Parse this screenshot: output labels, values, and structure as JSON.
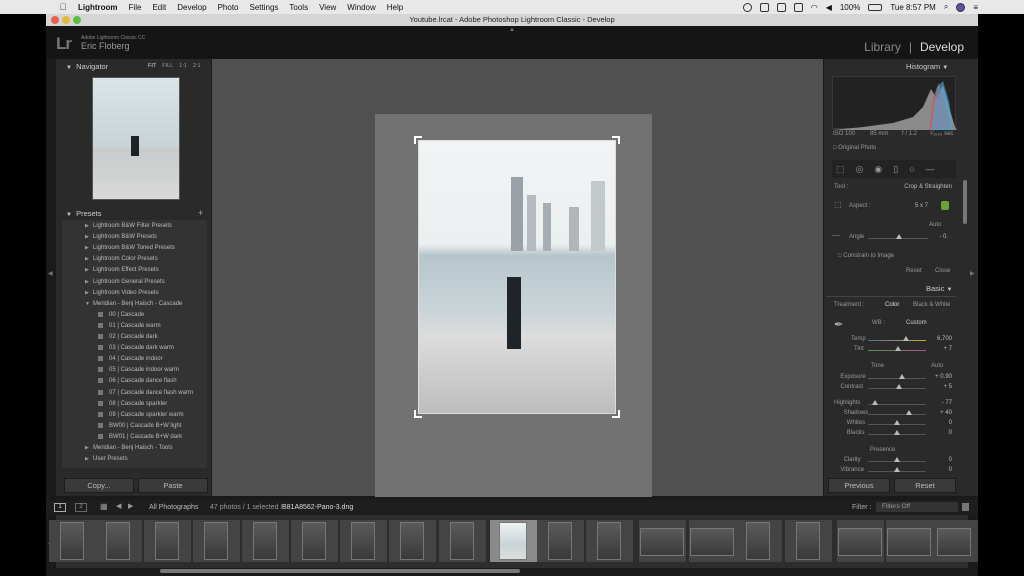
{
  "menubar": {
    "apple": "",
    "items": [
      "Lightroom",
      "File",
      "Edit",
      "Develop",
      "Photo",
      "Settings",
      "Tools",
      "View",
      "Window",
      "Help"
    ],
    "battery": "100%",
    "clock": "Tue 8:57 PM"
  },
  "window": {
    "title": "Youtube.lrcat - Adobe Photoshop Lightroom Classic - Develop"
  },
  "identity": {
    "logo": "Lr",
    "product": "Adobe Lightroom Classic CC",
    "user": "Eric Floberg"
  },
  "modules": {
    "library": "Library",
    "separator": "|",
    "develop": "Develop"
  },
  "navigator": {
    "title": "Navigator",
    "zoom_options": [
      "FIT",
      "FILL",
      "1:1",
      "2:1"
    ]
  },
  "presets": {
    "title": "Presets",
    "add": "+",
    "groups": [
      "Lightroom B&W Filter Presets",
      "Lightroom B&W Presets",
      "Lightroom B&W Toned Presets",
      "Lightroom Color Presets",
      "Lightroom Effect Presets",
      "Lightroom General Presets",
      "Lightroom Video Presets",
      "Meridian - Benj Haisch - Cascade"
    ],
    "items": [
      "00 | Cascade",
      "01 | Cascade warm",
      "02 | Cascade dark",
      "03 | Cascade dark warm",
      "04 | Cascade indoor",
      "05 | Cascade indoor warm",
      "06 | Cascade dance flash",
      "07 | Cascade dance flash warm",
      "08 | Cascade sparkler",
      "09 | Cascade sparkler warm",
      "BW00 | Cascade B+W light",
      "BW01 | Cascade B+W dark"
    ],
    "after": [
      "Meridian - Benj Haisch - Tools",
      "User Presets"
    ]
  },
  "left_buttons": {
    "copy": "Copy...",
    "paste": "Paste"
  },
  "histogram": {
    "title": "Histogram",
    "iso": "ISO 100",
    "focal": "85 mm",
    "aperture": "f / 1.2",
    "shutter": "¹⁄₁₆₀₀ sec",
    "original": "Original Photo"
  },
  "crop": {
    "tool_label": "Tool :",
    "tool_value": "Crop & Straighten",
    "aspect_label": "Aspect :",
    "aspect_value": "5 x 7",
    "auto": "Auto",
    "angle_label": "Angle",
    "angle_value": "- 0.",
    "constrain": "Constrain to Image",
    "reset": "Reset",
    "close": "Close"
  },
  "basic": {
    "title": "Basic",
    "treatment_label": "Treatment :",
    "color": "Color",
    "bw": "Black & White",
    "wb_label": "WB :",
    "wb_value": "Custom",
    "temp_label": "Temp",
    "temp_value": "6,700",
    "tint_label": "Tint",
    "tint_value": "+ 7",
    "tone_label": "Tone",
    "tone_auto": "Auto",
    "sliders": [
      {
        "label": "Exposure",
        "value": "+ 0.90",
        "level": 0.58
      },
      {
        "label": "Contrast",
        "value": "+ 5",
        "level": 0.53
      },
      {
        "label": "Highlights",
        "value": "- 77",
        "level": 0.12
      },
      {
        "label": "Shadows",
        "value": "+ 40",
        "level": 0.7
      },
      {
        "label": "Whites",
        "value": "0",
        "level": 0.5
      },
      {
        "label": "Blacks",
        "value": "0",
        "level": 0.5
      }
    ],
    "presence_label": "Presence",
    "presence_sliders": [
      {
        "label": "Clarity",
        "value": "0",
        "level": 0.5
      },
      {
        "label": "Vibrance",
        "value": "0",
        "level": 0.5
      }
    ]
  },
  "right_buttons": {
    "previous": "Previous",
    "reset": "Reset"
  },
  "filmstrip": {
    "page1": "1",
    "page2": "2",
    "source": "All Photographs",
    "count": "47 photos / 1 selected /",
    "filename": "B81A8562-Pano-3.dng",
    "filter_label": "Filter :",
    "filter_value": "Filters Off"
  },
  "colors": {
    "panel": "#2a2a2a",
    "center": "#505050",
    "accent": "#ffffff"
  }
}
